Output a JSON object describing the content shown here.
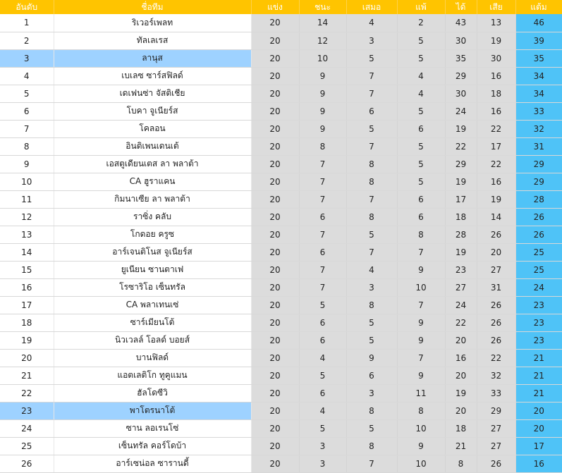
{
  "headers": {
    "rank": "อันดับ",
    "team": "ชื่อทีม",
    "played": "แข่ง",
    "won": "ชนะ",
    "drawn": "เสมอ",
    "lost": "แพ้",
    "goals_for": "ได้",
    "goals_against": "เสีย",
    "points": "แต้ม"
  },
  "colors": {
    "header_bg": "#ffc400",
    "stat_bg": "#dcdcdc",
    "points_bg": "#4fc3f7",
    "highlight_bg": "#9ed2ff"
  },
  "rows": [
    {
      "rank": "1",
      "team": "ริเวอร์เพลท",
      "played": "20",
      "won": "14",
      "drawn": "4",
      "lost": "2",
      "gf": "43",
      "ga": "13",
      "pts": "46",
      "highlight": false
    },
    {
      "rank": "2",
      "team": "ทัลเลเรส",
      "played": "20",
      "won": "12",
      "drawn": "3",
      "lost": "5",
      "gf": "30",
      "ga": "19",
      "pts": "39",
      "highlight": false
    },
    {
      "rank": "3",
      "team": "ลานุส",
      "played": "20",
      "won": "10",
      "drawn": "5",
      "lost": "5",
      "gf": "35",
      "ga": "30",
      "pts": "35",
      "highlight": true
    },
    {
      "rank": "4",
      "team": "เบเลซ ซาร์สฟิลด์",
      "played": "20",
      "won": "9",
      "drawn": "7",
      "lost": "4",
      "gf": "29",
      "ga": "16",
      "pts": "34",
      "highlight": false
    },
    {
      "rank": "5",
      "team": "เดเฟนซ่า จัสติเชีย",
      "played": "20",
      "won": "9",
      "drawn": "7",
      "lost": "4",
      "gf": "30",
      "ga": "18",
      "pts": "34",
      "highlight": false
    },
    {
      "rank": "6",
      "team": "โบคา จูเนียร์ส",
      "played": "20",
      "won": "9",
      "drawn": "6",
      "lost": "5",
      "gf": "24",
      "ga": "16",
      "pts": "33",
      "highlight": false
    },
    {
      "rank": "7",
      "team": "โคลอน",
      "played": "20",
      "won": "9",
      "drawn": "5",
      "lost": "6",
      "gf": "19",
      "ga": "22",
      "pts": "32",
      "highlight": false
    },
    {
      "rank": "8",
      "team": "อินดิเพนเดนเต้",
      "played": "20",
      "won": "8",
      "drawn": "7",
      "lost": "5",
      "gf": "22",
      "ga": "17",
      "pts": "31",
      "highlight": false
    },
    {
      "rank": "9",
      "team": "เอสตูเดียนเตส ลา พลาต้า",
      "played": "20",
      "won": "7",
      "drawn": "8",
      "lost": "5",
      "gf": "29",
      "ga": "22",
      "pts": "29",
      "highlight": false
    },
    {
      "rank": "10",
      "team": "CA ฮูราแคน",
      "played": "20",
      "won": "7",
      "drawn": "8",
      "lost": "5",
      "gf": "19",
      "ga": "16",
      "pts": "29",
      "highlight": false
    },
    {
      "rank": "11",
      "team": "กิมนาเซีย ลา พลาต้า",
      "played": "20",
      "won": "7",
      "drawn": "7",
      "lost": "6",
      "gf": "17",
      "ga": "19",
      "pts": "28",
      "highlight": false
    },
    {
      "rank": "12",
      "team": "ราซิ่ง คลับ",
      "played": "20",
      "won": "6",
      "drawn": "8",
      "lost": "6",
      "gf": "18",
      "ga": "14",
      "pts": "26",
      "highlight": false
    },
    {
      "rank": "13",
      "team": "โกดอย ครูซ",
      "played": "20",
      "won": "7",
      "drawn": "5",
      "lost": "8",
      "gf": "28",
      "ga": "26",
      "pts": "26",
      "highlight": false
    },
    {
      "rank": "14",
      "team": "อาร์เจนติโนส จูเนียร์ส",
      "played": "20",
      "won": "6",
      "drawn": "7",
      "lost": "7",
      "gf": "19",
      "ga": "20",
      "pts": "25",
      "highlight": false
    },
    {
      "rank": "15",
      "team": "ยูเนียน ซานตาเฟ",
      "played": "20",
      "won": "7",
      "drawn": "4",
      "lost": "9",
      "gf": "23",
      "ga": "27",
      "pts": "25",
      "highlight": false
    },
    {
      "rank": "16",
      "team": "โรซาริโอ เซ็นทรัล",
      "played": "20",
      "won": "7",
      "drawn": "3",
      "lost": "10",
      "gf": "27",
      "ga": "31",
      "pts": "24",
      "highlight": false
    },
    {
      "rank": "17",
      "team": "CA พลาเทนเซ่",
      "played": "20",
      "won": "5",
      "drawn": "8",
      "lost": "7",
      "gf": "24",
      "ga": "26",
      "pts": "23",
      "highlight": false
    },
    {
      "rank": "18",
      "team": "ซาร์เมียนโต้",
      "played": "20",
      "won": "6",
      "drawn": "5",
      "lost": "9",
      "gf": "22",
      "ga": "26",
      "pts": "23",
      "highlight": false
    },
    {
      "rank": "19",
      "team": "นิวเวลล์ โอลด์ บอยส์",
      "played": "20",
      "won": "6",
      "drawn": "5",
      "lost": "9",
      "gf": "20",
      "ga": "26",
      "pts": "23",
      "highlight": false
    },
    {
      "rank": "20",
      "team": "บานฟิลด์",
      "played": "20",
      "won": "4",
      "drawn": "9",
      "lost": "7",
      "gf": "16",
      "ga": "22",
      "pts": "21",
      "highlight": false
    },
    {
      "rank": "21",
      "team": "แอตเลติโก ทูคูแมน",
      "played": "20",
      "won": "5",
      "drawn": "6",
      "lost": "9",
      "gf": "20",
      "ga": "32",
      "pts": "21",
      "highlight": false
    },
    {
      "rank": "22",
      "team": "ฮัลโดซีวิ",
      "played": "20",
      "won": "6",
      "drawn": "3",
      "lost": "11",
      "gf": "19",
      "ga": "33",
      "pts": "21",
      "highlight": false
    },
    {
      "rank": "23",
      "team": "พาโตรนาโต้",
      "played": "20",
      "won": "4",
      "drawn": "8",
      "lost": "8",
      "gf": "20",
      "ga": "29",
      "pts": "20",
      "highlight": true
    },
    {
      "rank": "24",
      "team": "ซาน ลอเรนโซ่",
      "played": "20",
      "won": "5",
      "drawn": "5",
      "lost": "10",
      "gf": "18",
      "ga": "27",
      "pts": "20",
      "highlight": false
    },
    {
      "rank": "25",
      "team": "เซ็นทรัล คอร์โดบ้า",
      "played": "20",
      "won": "3",
      "drawn": "8",
      "lost": "9",
      "gf": "21",
      "ga": "27",
      "pts": "17",
      "highlight": false
    },
    {
      "rank": "26",
      "team": "อาร์เซน่อล ซารานดี้",
      "played": "20",
      "won": "3",
      "drawn": "7",
      "lost": "10",
      "gf": "8",
      "ga": "26",
      "pts": "16",
      "highlight": false
    }
  ]
}
